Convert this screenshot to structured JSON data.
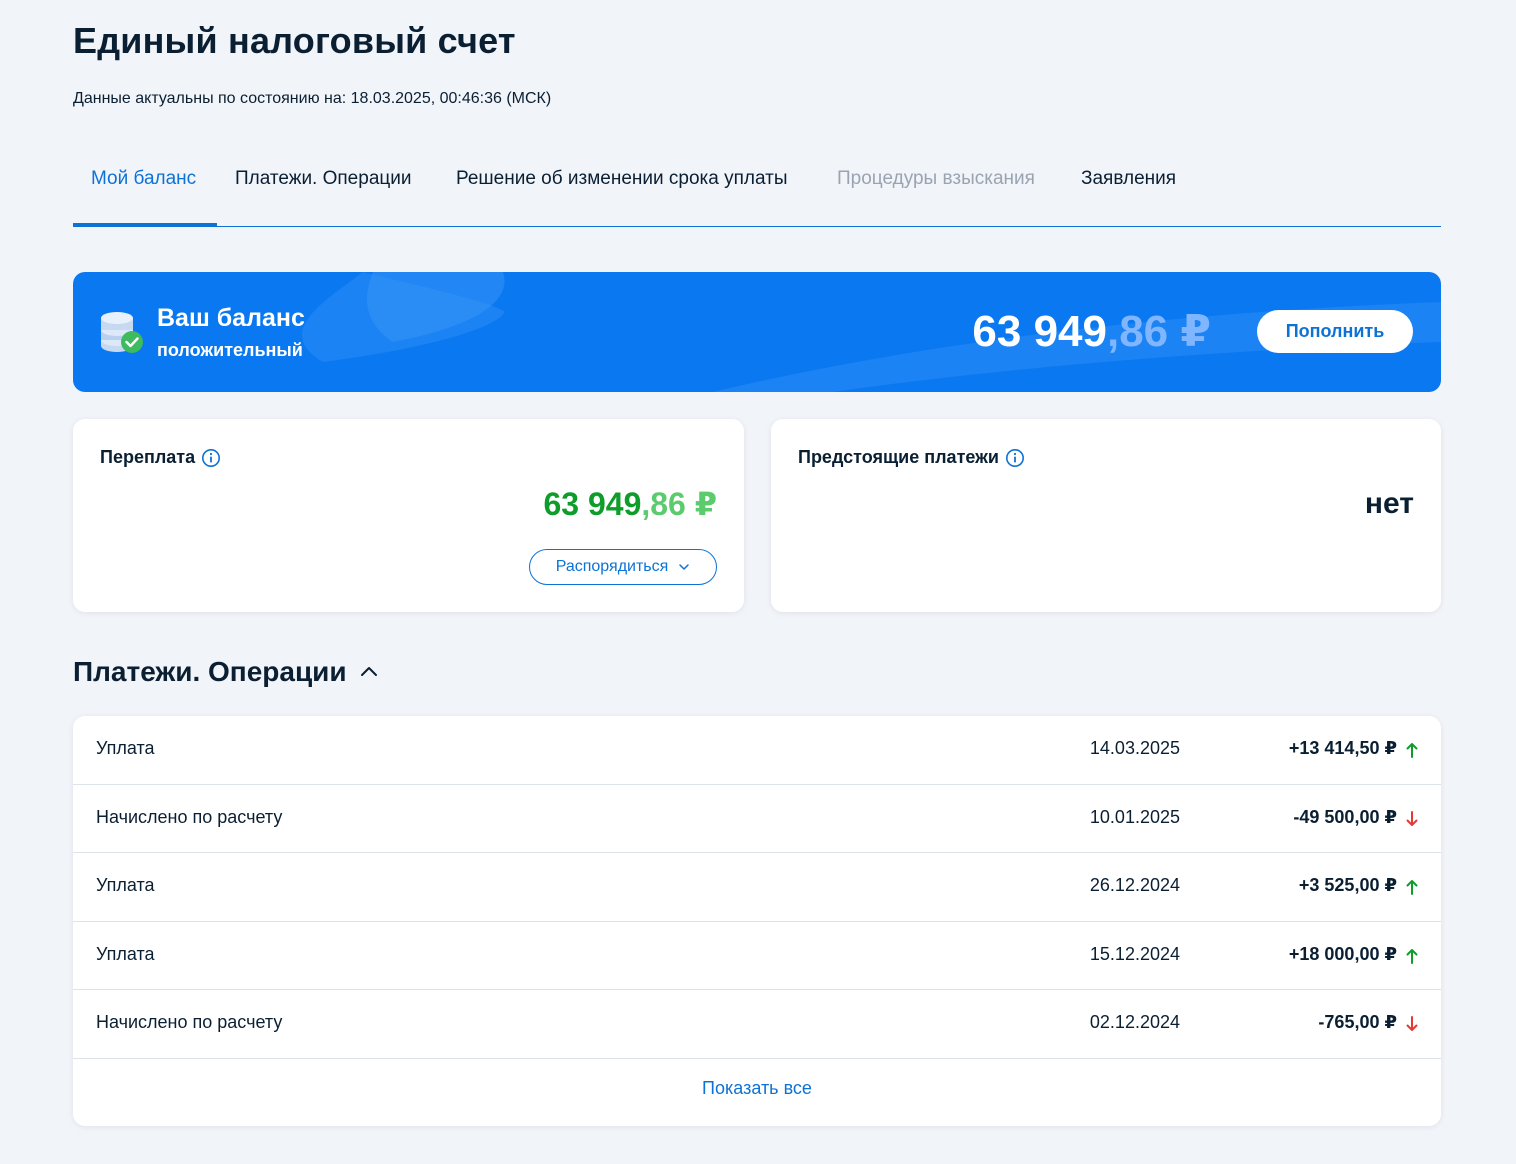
{
  "page": {
    "title": "Единый налоговый счет",
    "updated": "Данные актуальны по состоянию на: 18.03.2025, 00:46:36 (МСК)"
  },
  "tabs": [
    {
      "label": "Мой баланс",
      "state": "active"
    },
    {
      "label": "Платежи. Операции",
      "state": "normal"
    },
    {
      "label": "Решение об изменении срока уплаты",
      "state": "normal"
    },
    {
      "label": "Процедуры взыскания",
      "state": "disabled"
    },
    {
      "label": "Заявления",
      "state": "normal"
    }
  ],
  "balance": {
    "title": "Ваш баланс",
    "subtitle": "положительный",
    "amount_int": "63 949",
    "amount_frac": ",86 ₽",
    "topup_label": "Пополнить",
    "icon": "coins-check-icon"
  },
  "overpayment": {
    "title": "Переплата",
    "amount_int": "63 949",
    "amount_frac": ",86 ₽",
    "action_label": "Распорядиться"
  },
  "upcoming": {
    "title": "Предстоящие платежи",
    "value": "нет"
  },
  "operations": {
    "title": "Платежи. Операции",
    "rows": [
      {
        "type": "Уплата",
        "date": "14.03.2025",
        "amount": "+13 414,50 ₽",
        "direction": "up"
      },
      {
        "type": "Начислено по расчету",
        "date": "10.01.2025",
        "amount": "-49 500,00 ₽",
        "direction": "down"
      },
      {
        "type": "Уплата",
        "date": "26.12.2024",
        "amount": "+3 525,00 ₽",
        "direction": "up"
      },
      {
        "type": "Уплата",
        "date": "15.12.2024",
        "amount": "+18 000,00 ₽",
        "direction": "up"
      },
      {
        "type": "Начислено по расчету",
        "date": "02.12.2024",
        "amount": "-765,00 ₽",
        "direction": "down"
      }
    ],
    "show_all_label": "Показать все"
  },
  "colors": {
    "accent": "#0d72d6",
    "banner": "#0a78f0",
    "positive": "#0e9d2a",
    "negative": "#e53935",
    "text": "#0b1f33"
  }
}
